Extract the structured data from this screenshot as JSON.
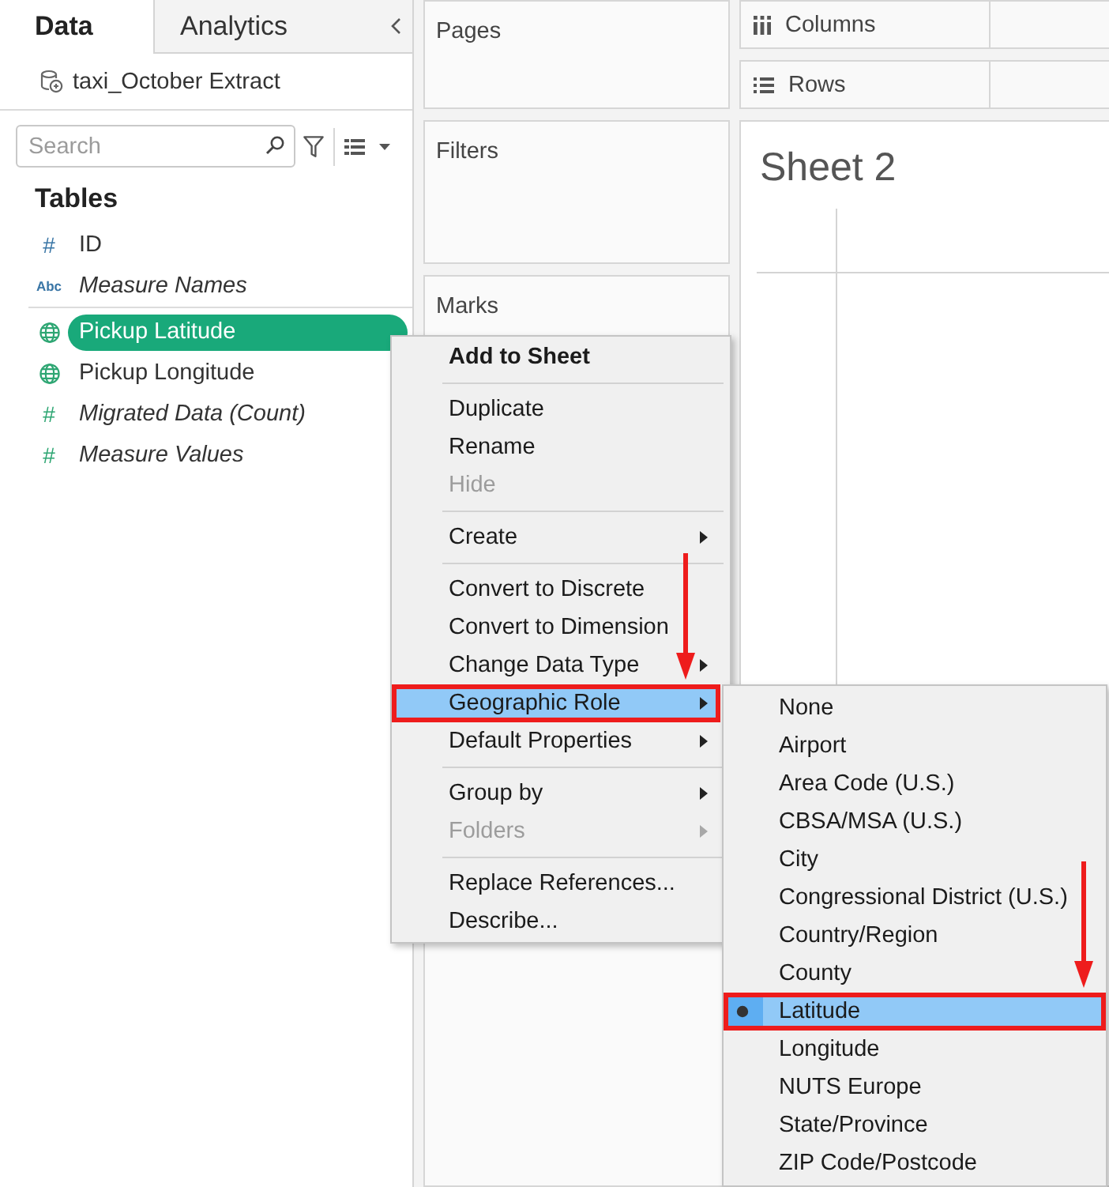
{
  "data_pane": {
    "tabs": [
      {
        "label": "Data",
        "selected": true
      },
      {
        "label": "Analytics",
        "selected": false
      }
    ],
    "data_source": "taxi_October Extract",
    "search": {
      "placeholder": "Search"
    },
    "section_title": "Tables",
    "field_groups": [
      {
        "color": "#3a76a6",
        "fields": [
          {
            "name": "ID",
            "kind": "number",
            "type_glyph": "#",
            "generated": false,
            "selected": false
          },
          {
            "name": "Measure Names",
            "kind": "text",
            "type_glyph": "Abc",
            "generated": true,
            "selected": false
          }
        ]
      },
      {
        "color": "#2ea673",
        "fields": [
          {
            "name": "Pickup Latitude",
            "kind": "geo",
            "generated": false,
            "selected": true
          },
          {
            "name": "Pickup Longitude",
            "kind": "geo",
            "generated": false,
            "selected": false
          },
          {
            "name": "Migrated Data (Count)",
            "kind": "number",
            "type_glyph": "#",
            "generated": true,
            "selected": false
          },
          {
            "name": "Measure Values",
            "kind": "number",
            "type_glyph": "#",
            "generated": true,
            "selected": false
          }
        ]
      }
    ]
  },
  "cards": [
    {
      "title": "Pages"
    },
    {
      "title": "Filters"
    },
    {
      "title": "Marks"
    }
  ],
  "shelves": [
    {
      "kind": "columns",
      "label": "Columns"
    },
    {
      "kind": "rows",
      "label": "Rows"
    }
  ],
  "sheet": {
    "title": "Sheet 2"
  },
  "context_menu": {
    "groups": [
      {
        "items": [
          {
            "kind": "command",
            "label": "Add to Sheet",
            "default": true,
            "disabled": false,
            "has_submenu": false,
            "highlighted": false,
            "callout": false
          }
        ]
      },
      {
        "items": [
          {
            "kind": "command",
            "label": "Duplicate",
            "default": false,
            "disabled": false,
            "has_submenu": false,
            "highlighted": false,
            "callout": false
          },
          {
            "kind": "command",
            "label": "Rename",
            "default": false,
            "disabled": false,
            "has_submenu": false,
            "highlighted": false,
            "callout": false
          },
          {
            "kind": "command",
            "label": "Hide",
            "default": false,
            "disabled": true,
            "has_submenu": false,
            "highlighted": false,
            "callout": false
          }
        ]
      },
      {
        "items": [
          {
            "kind": "command",
            "label": "Create",
            "default": false,
            "disabled": false,
            "has_submenu": true,
            "highlighted": false,
            "callout": false
          }
        ]
      },
      {
        "items": [
          {
            "kind": "command",
            "label": "Convert to Discrete",
            "default": false,
            "disabled": false,
            "has_submenu": false,
            "highlighted": false,
            "callout": false
          },
          {
            "kind": "command",
            "label": "Convert to Dimension",
            "default": false,
            "disabled": false,
            "has_submenu": false,
            "highlighted": false,
            "callout": false
          },
          {
            "kind": "command",
            "label": "Change Data Type",
            "default": false,
            "disabled": false,
            "has_submenu": true,
            "highlighted": false,
            "callout": false
          },
          {
            "kind": "command",
            "label": "Geographic Role",
            "default": false,
            "disabled": false,
            "has_submenu": true,
            "highlighted": true,
            "callout": true
          },
          {
            "kind": "command",
            "label": "Default Properties",
            "default": false,
            "disabled": false,
            "has_submenu": true,
            "highlighted": false,
            "callout": false
          }
        ]
      },
      {
        "items": [
          {
            "kind": "command",
            "label": "Group by",
            "default": false,
            "disabled": false,
            "has_submenu": true,
            "highlighted": false,
            "callout": false
          },
          {
            "kind": "command",
            "label": "Folders",
            "default": false,
            "disabled": true,
            "has_submenu": true,
            "highlighted": false,
            "callout": false
          }
        ]
      },
      {
        "items": [
          {
            "kind": "command",
            "label": "Replace References...",
            "default": false,
            "disabled": false,
            "has_submenu": false,
            "highlighted": false,
            "callout": false
          },
          {
            "kind": "command",
            "label": "Describe...",
            "default": false,
            "disabled": false,
            "has_submenu": false,
            "highlighted": false,
            "callout": false
          }
        ]
      }
    ]
  },
  "submenu": {
    "items": [
      {
        "kind": "radio",
        "label": "None",
        "selected": false,
        "highlighted": false,
        "callout": false
      },
      {
        "kind": "radio",
        "label": "Airport",
        "selected": false,
        "highlighted": false,
        "callout": false
      },
      {
        "kind": "radio",
        "label": "Area Code (U.S.)",
        "selected": false,
        "highlighted": false,
        "callout": false
      },
      {
        "kind": "radio",
        "label": "CBSA/MSA (U.S.)",
        "selected": false,
        "highlighted": false,
        "callout": false
      },
      {
        "kind": "radio",
        "label": "City",
        "selected": false,
        "highlighted": false,
        "callout": false
      },
      {
        "kind": "radio",
        "label": "Congressional District (U.S.)",
        "selected": false,
        "highlighted": false,
        "callout": false
      },
      {
        "kind": "radio",
        "label": "Country/Region",
        "selected": false,
        "highlighted": false,
        "callout": false
      },
      {
        "kind": "radio",
        "label": "County",
        "selected": false,
        "highlighted": false,
        "callout": false
      },
      {
        "kind": "radio",
        "label": "Latitude",
        "selected": true,
        "highlighted": true,
        "callout": true
      },
      {
        "kind": "radio",
        "label": "Longitude",
        "selected": false,
        "highlighted": false,
        "callout": false
      },
      {
        "kind": "radio",
        "label": "NUTS Europe",
        "selected": false,
        "highlighted": false,
        "callout": false
      },
      {
        "kind": "radio",
        "label": "State/Province",
        "selected": false,
        "highlighted": false,
        "callout": false
      },
      {
        "kind": "radio",
        "label": "ZIP Code/Postcode",
        "selected": false,
        "highlighted": false,
        "callout": false
      }
    ]
  }
}
